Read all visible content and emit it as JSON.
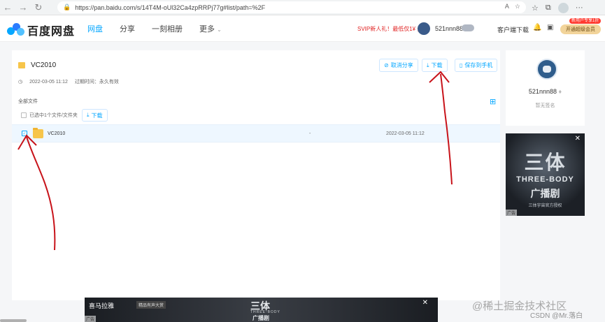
{
  "browser": {
    "url": "https://pan.baidu.com/s/14T4M-oUl32Ca4zpRRPj77g#list/path=%2F",
    "back_icon": "arrow-left-icon",
    "forward_icon": "arrow-right-icon",
    "refresh_icon": "refresh-icon"
  },
  "header": {
    "logo_text": "百度网盘",
    "nav": [
      "网盘",
      "分享",
      "一刻相册",
      "更多"
    ],
    "svip_promo": "SVIP新人礼！最低仅1¥ 元",
    "username": "521nnn88",
    "client_download": "客户端下载",
    "open_vip": "开通超级会员",
    "newuser_tag": "新用户专享1折"
  },
  "share": {
    "folder_name": "VC2010",
    "date": "2022-03-05 11:12",
    "expiry_label": "过期时间：",
    "expiry_value": "永久有效",
    "cancel_share": "取消分享",
    "download": "下载",
    "save_phone": "保存到手机",
    "all_files": "全部文件",
    "selected_text": "已选中1个文件/文件夹",
    "download_small": "下载"
  },
  "files": [
    {
      "name": "VC2010",
      "size": "-",
      "time": "2022-03-05 11:12",
      "checked": true
    }
  ],
  "sidebar": {
    "username": "521nnn88",
    "signature": "暂无签名"
  },
  "ad_right": {
    "title_cn": "三体",
    "title_en": "THREE-BODY",
    "subtitle": "广播剧",
    "credit": "三体宇宙官方授权",
    "tag": "广告"
  },
  "ad_bottom": {
    "logo": "喜马拉雅",
    "slogan": "精品有声大赏",
    "title_cn": "三体",
    "title_en": "THREE-BODY",
    "subtitle": "广播剧",
    "tag": "广告"
  },
  "watermark": {
    "line1": "@稀土掘金技术社区",
    "line2": "CSDN @Mr.落白"
  }
}
